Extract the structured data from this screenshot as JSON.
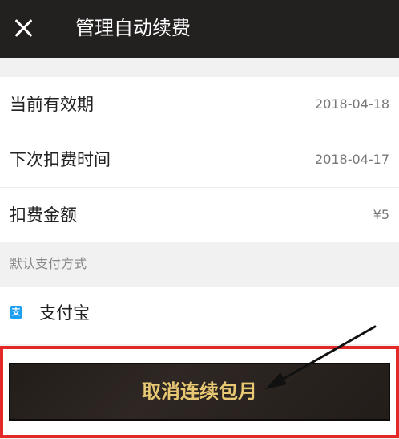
{
  "header": {
    "title": "管理自动续费",
    "close_icon": "close-icon"
  },
  "rows": [
    {
      "label": "当前有效期",
      "value": "2018-04-18"
    },
    {
      "label": "下次扣费时间",
      "value": "2018-04-17"
    },
    {
      "label": "扣费金额",
      "value": "¥5"
    }
  ],
  "payment": {
    "section_label": "默认支付方式",
    "method_label": "支付宝",
    "method_icon": "alipay-icon",
    "icon_glyph": "支"
  },
  "action": {
    "cancel_label": "取消连续包月"
  },
  "colors": {
    "header_bg": "#232020",
    "button_bg": "#231d1a",
    "button_text": "#e8c873",
    "highlight_border": "#e32828",
    "alipay_blue": "#1b9ef2"
  }
}
